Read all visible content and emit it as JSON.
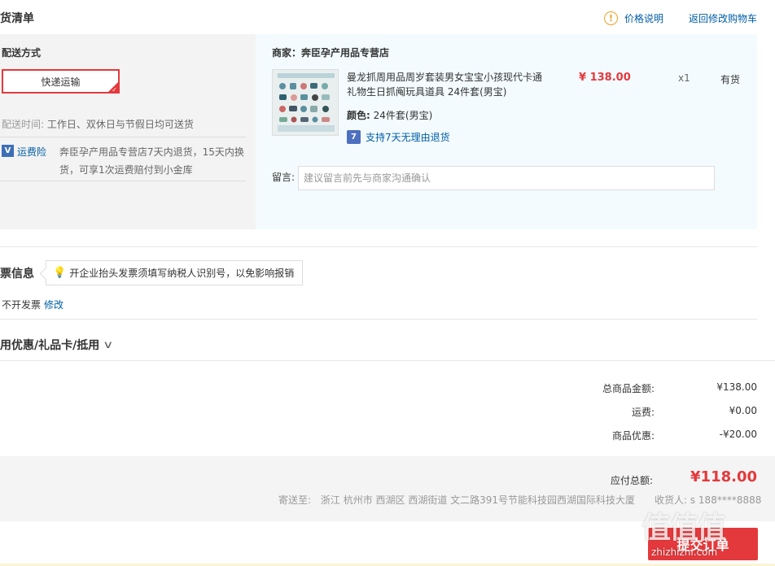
{
  "header": {
    "title": "货清单",
    "price_note": "价格说明",
    "back_link": "返回修改购物车"
  },
  "shipping": {
    "title": "配送方式",
    "method": "快递运输",
    "time_label": "配送时间:",
    "time_value": "工作日、双休日与节假日均可送货",
    "insurance_icon": "V",
    "insurance_label": "运费险",
    "insurance_text": "奔臣孕产用品专营店7天内退货，15天内换货，可享1次运费赔付到小金库"
  },
  "product": {
    "shop": "商家：奔臣孕产用品专营店",
    "name": "曼龙抓周用品周岁套装男女宝宝小孩现代卡通礼物生日抓阄玩具道具 24件套(男宝)",
    "price": "¥ 138.00",
    "qty": "x1",
    "stock": "有货",
    "color_label": "颜色:",
    "color_value": "24件套(男宝)",
    "return_icon": "7",
    "return_text": "支持7天无理由退货",
    "message_label": "留言:",
    "message_placeholder": "建议留言前先与商家沟通确认"
  },
  "invoice": {
    "title": "票信息",
    "tip": "开企业抬头发票须填写纳税人识别号，以免影响报销",
    "value": "不开发票",
    "edit": "修改"
  },
  "coupon": {
    "title": "用优惠/礼品卡/抵用",
    "chevron": "∨"
  },
  "summary": {
    "items": [
      {
        "label": "总商品金额:",
        "value": "¥138.00"
      },
      {
        "label": "运费:",
        "value": "¥0.00"
      },
      {
        "label": "商品优惠:",
        "value": "-¥20.00"
      }
    ],
    "pay_label": "应付总额:",
    "pay_value": "¥118.00",
    "address_label": "寄送至:",
    "address_value": "浙江 杭州市 西湖区 西湖街道 文二路391号节能科技园西湖国际科技大厦",
    "receiver": "收货人: s 188****8888",
    "submit": "提交订单"
  },
  "watermark": {
    "main": "值值值",
    "sub": "zhizhizhi.com"
  },
  "colors": {
    "accent": "#e4393c",
    "link": "#005ea7",
    "product_bg": "#f3fbfe",
    "shipping_bg": "#f3f3f3"
  }
}
